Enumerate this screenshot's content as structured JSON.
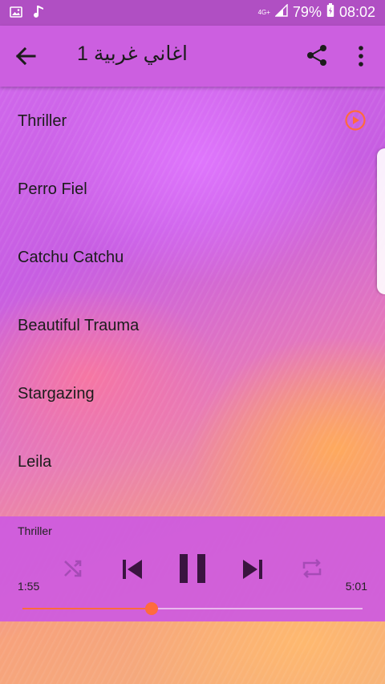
{
  "status_bar": {
    "network": "4G+",
    "battery": "79%",
    "time": "08:02",
    "icons": [
      "image-icon",
      "music-note-icon",
      "signal-icon",
      "battery-icon"
    ]
  },
  "app_bar": {
    "title": "اغاني غربية 1",
    "icons": [
      "back-arrow-icon",
      "share-icon",
      "more-vert-icon"
    ]
  },
  "songs": [
    {
      "title": "Thriller",
      "playing": true
    },
    {
      "title": "Perro Fiel",
      "playing": false
    },
    {
      "title": "Catchu Catchu",
      "playing": false
    },
    {
      "title": "Beautiful Trauma",
      "playing": false
    },
    {
      "title": "Stargazing",
      "playing": false
    },
    {
      "title": "Leila",
      "playing": false
    }
  ],
  "player": {
    "now_playing": "Thriller",
    "elapsed": "1:55",
    "total": "5:01",
    "progress": 0.38,
    "accent_color": "#ff6b3d",
    "icons": [
      "shuffle-icon",
      "skip-previous-icon",
      "pause-icon",
      "skip-next-icon",
      "repeat-icon"
    ]
  }
}
